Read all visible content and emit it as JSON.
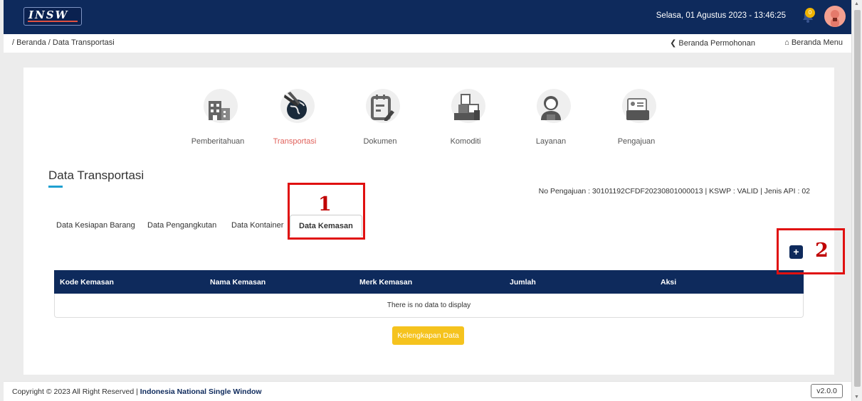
{
  "app": {
    "logo_text": "INSW",
    "datetime": "Selasa, 01 Agustus 2023 - 13:46:25",
    "notification_count": "0"
  },
  "breadcrumb": "/ Beranda / Data Transportasi",
  "nav_links": {
    "beranda_permohonan": "❮ Beranda Permohonan",
    "beranda_menu": "⌂ Beranda Menu"
  },
  "steps": [
    {
      "label": "Pemberitahuan",
      "icon": "building-icon",
      "active": false
    },
    {
      "label": "Transportasi",
      "icon": "airplane-globe-icon",
      "active": true
    },
    {
      "label": "Dokumen",
      "icon": "document-edit-icon",
      "active": false
    },
    {
      "label": "Komoditi",
      "icon": "boxes-icon",
      "active": false
    },
    {
      "label": "Layanan",
      "icon": "customer-service-icon",
      "active": false
    },
    {
      "label": "Pengajuan",
      "icon": "folder-card-icon",
      "active": false
    }
  ],
  "section": {
    "title": "Data Transportasi",
    "meta": "No Pengajuan : 30101192CFDF20230801000013 | KSWP : VALID | Jenis API : 02"
  },
  "tabs": [
    {
      "label": "Data Kesiapan Barang",
      "active": false
    },
    {
      "label": "Data Pengangkutan",
      "active": false
    },
    {
      "label": "Data Kontainer",
      "active": false
    },
    {
      "label": "Data Kemasan",
      "active": true
    }
  ],
  "add_button_label": "+",
  "table": {
    "columns": [
      "Kode Kemasan",
      "Nama Kemasan",
      "Merk Kemasan",
      "Jumlah",
      "Aksi"
    ],
    "empty_text": "There is no data to display"
  },
  "kelengkapan_button": "Kelengkapan Data",
  "annotations": [
    "1",
    "2"
  ],
  "footer": {
    "copyright": "Copyright © 2023 All Right Reserved |",
    "brand": "Indonesia National Single Window",
    "version": "v2.0.0"
  },
  "colors": {
    "primary": "#0e2a5c",
    "active_step": "#e0605a",
    "accent_button": "#f5c31e",
    "annotation": "#e01010"
  }
}
